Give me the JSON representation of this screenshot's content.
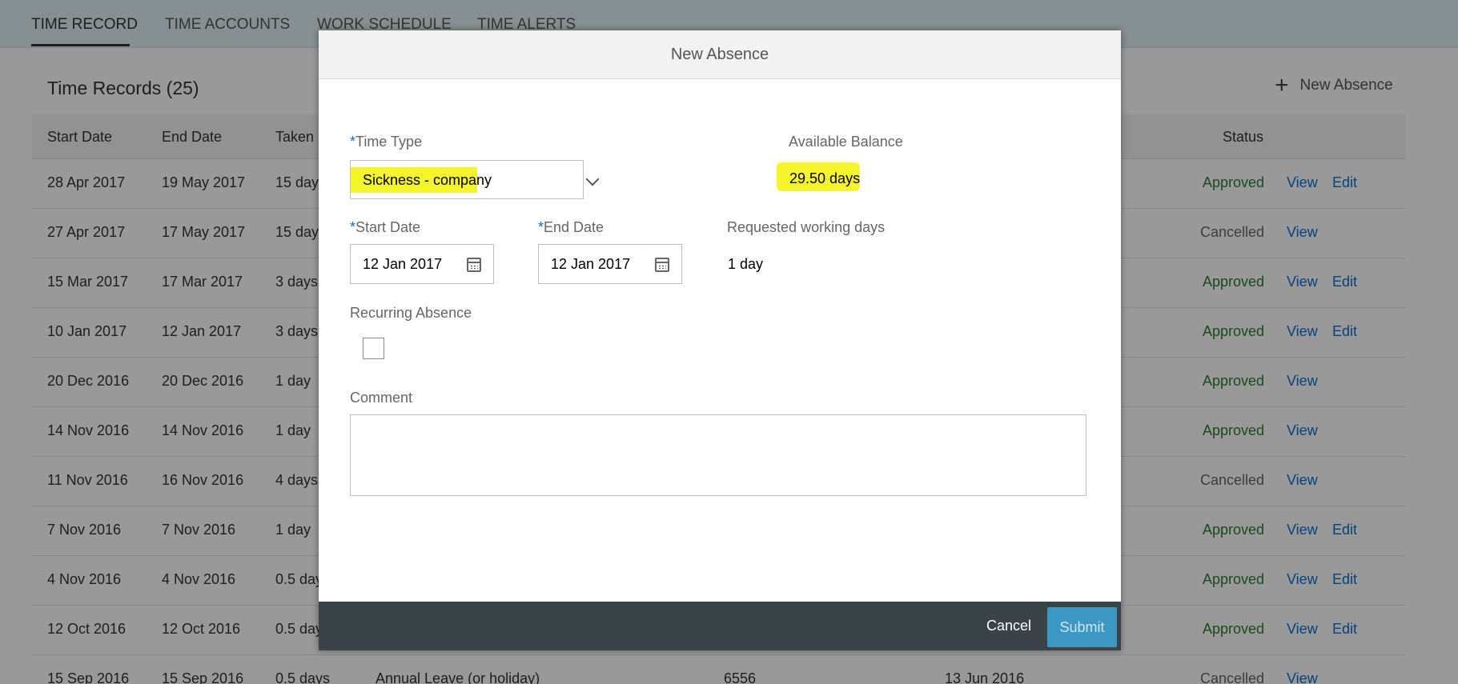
{
  "nav": {
    "tabs": [
      {
        "label": "TIME RECORD"
      },
      {
        "label": "TIME ACCOUNTS"
      },
      {
        "label": "WORK SCHEDULE"
      },
      {
        "label": "TIME ALERTS"
      }
    ]
  },
  "records": {
    "title": "Time Records (25)",
    "new_absence_label": "New Absence",
    "columns": {
      "start": "Start Date",
      "end": "End Date",
      "taken": "Taken",
      "status": "Status"
    },
    "rows": [
      {
        "start": "28 Apr 2017",
        "end": "19 May 2017",
        "taken": "15 days",
        "status": "Approved",
        "view": "View",
        "edit": "Edit"
      },
      {
        "start": "27 Apr 2017",
        "end": "17 May 2017",
        "taken": "15 days",
        "status": "Cancelled",
        "view": "View",
        "edit": ""
      },
      {
        "start": "15 Mar 2017",
        "end": "17 Mar 2017",
        "taken": "3 days",
        "status": "Approved",
        "view": "View",
        "edit": "Edit"
      },
      {
        "start": "10 Jan 2017",
        "end": "12 Jan 2017",
        "taken": "3 days",
        "status": "Approved",
        "view": "View",
        "edit": "Edit"
      },
      {
        "start": "20 Dec 2016",
        "end": "20 Dec 2016",
        "taken": "1 day",
        "status": "Approved",
        "view": "View",
        "edit": ""
      },
      {
        "start": "14 Nov 2016",
        "end": "14 Nov 2016",
        "taken": "1 day",
        "status": "Approved",
        "view": "View",
        "edit": ""
      },
      {
        "start": "11 Nov 2016",
        "end": "16 Nov 2016",
        "taken": "4 days",
        "status": "Cancelled",
        "view": "View",
        "edit": ""
      },
      {
        "start": "7 Nov 2016",
        "end": "7 Nov 2016",
        "taken": "1 day",
        "status": "Approved",
        "view": "View",
        "edit": "Edit"
      },
      {
        "start": "4 Nov 2016",
        "end": "4 Nov 2016",
        "taken": "0.5 days",
        "status": "Approved",
        "view": "View",
        "edit": "Edit"
      },
      {
        "start": "12 Oct 2016",
        "end": "12 Oct 2016",
        "taken": "0.5 days",
        "status": "Approved",
        "view": "View",
        "edit": "Edit"
      },
      {
        "start": "15 Sep 2016",
        "end": "15 Sep 2016",
        "taken": "0.5 days",
        "status": "Cancelled",
        "view": "View",
        "edit": "",
        "type": "Annual Leave (or holiday)",
        "id": "6556",
        "date": "13 Jun 2016"
      }
    ]
  },
  "dialog": {
    "title": "New Absence",
    "required_mark": "*",
    "time_type": {
      "label": "Time Type",
      "value": "Sickness - company"
    },
    "balance": {
      "label": "Available Balance",
      "value": "29.50 days"
    },
    "start_date": {
      "label": "Start Date",
      "value": "12 Jan 2017"
    },
    "end_date": {
      "label": "End Date",
      "value": "12 Jan 2017"
    },
    "requested": {
      "label": "Requested working days",
      "value": "1 day"
    },
    "recurring": {
      "label": "Recurring Absence"
    },
    "comment": {
      "label": "Comment"
    },
    "cancel_label": "Cancel",
    "submit_label": "Submit"
  },
  "colors": {
    "highlight": "#f6f52b",
    "approved": "#2b7d2b",
    "link": "#0a6ed1",
    "submit": "#3d97c4",
    "footer": "#3a4348"
  },
  "icons": [
    "plus-icon",
    "chevron-down-icon",
    "calendar-icon"
  ]
}
